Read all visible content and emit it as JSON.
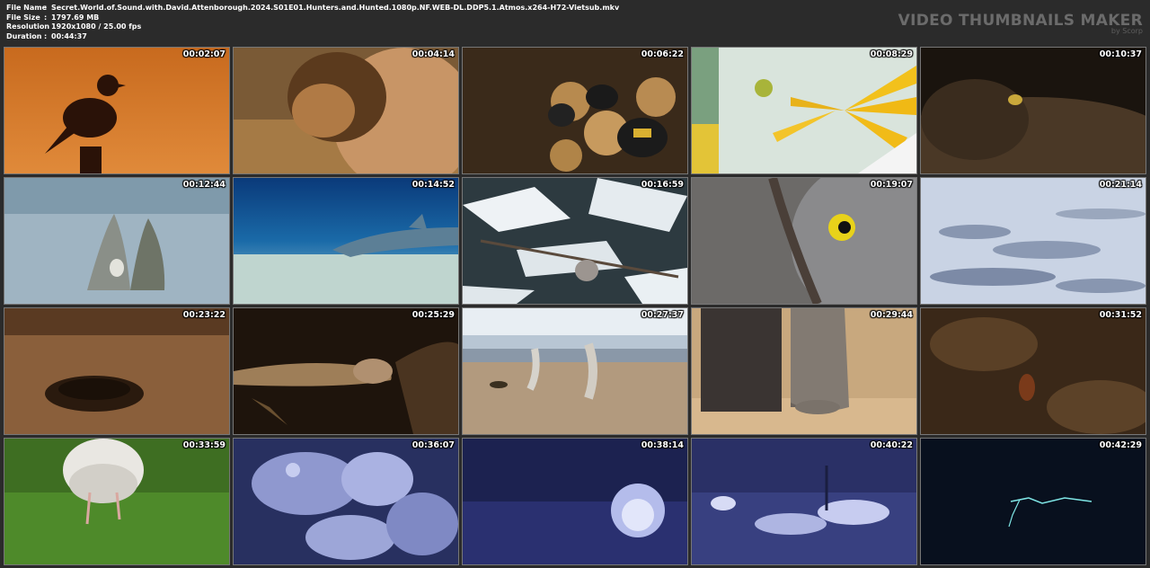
{
  "header": {
    "file_name_label": "File Name",
    "file_name": "Secret.World.of.Sound.with.David.Attenborough.2024.S01E01.Hunters.and.Hunted.1080p.NF.WEB-DL.DDP5.1.Atmos.x264-H72-Vietsub.mkv",
    "file_size_label": "File Size",
    "file_size": "1797.69 MB",
    "resolution_label": "Resolution",
    "resolution": "1920x1080 / 25.00 fps",
    "duration_label": "Duration",
    "duration": "00:44:37",
    "separator": ":"
  },
  "brand": {
    "title": "VIDEO THUMBNAILS MAKER",
    "subtitle": "by Scorp"
  },
  "thumbnails": [
    {
      "time": "00:02:07",
      "scene": "bird-silhouette-sunset"
    },
    {
      "time": "00:04:14",
      "scene": "lion-grassland"
    },
    {
      "time": "00:06:22",
      "scene": "bumblebee-nest"
    },
    {
      "time": "00:08:29",
      "scene": "flower-stamens"
    },
    {
      "time": "00:10:37",
      "scene": "beetle-burrow"
    },
    {
      "time": "00:12:44",
      "scene": "clam-seafloor"
    },
    {
      "time": "00:14:52",
      "scene": "dolphin-underwater"
    },
    {
      "time": "00:16:59",
      "scene": "owl-snowy-forest"
    },
    {
      "time": "00:19:07",
      "scene": "owl-eye-closeup"
    },
    {
      "time": "00:21:14",
      "scene": "snow-field"
    },
    {
      "time": "00:23:22",
      "scene": "sand-burrow"
    },
    {
      "time": "00:25:29",
      "scene": "rattlesnake-night"
    },
    {
      "time": "00:27:37",
      "scene": "dust-devils-savanna"
    },
    {
      "time": "00:29:44",
      "scene": "elephant-legs"
    },
    {
      "time": "00:31:52",
      "scene": "cricket-soil"
    },
    {
      "time": "00:33:59",
      "scene": "gull-on-grass"
    },
    {
      "time": "00:36:07",
      "scene": "hyenas-night-vision"
    },
    {
      "time": "00:38:14",
      "scene": "porcupine-night-vision"
    },
    {
      "time": "00:40:22",
      "scene": "lions-zebra-night-vision"
    },
    {
      "time": "00:42:29",
      "scene": "lightning-night"
    }
  ]
}
